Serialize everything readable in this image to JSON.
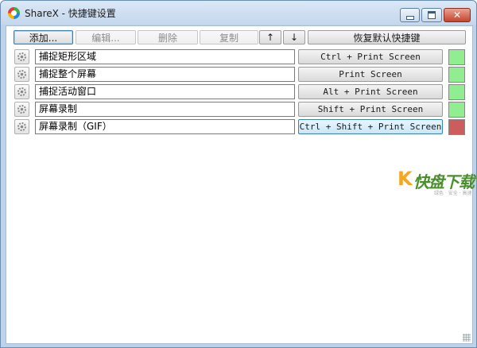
{
  "window": {
    "title": "ShareX - 快捷键设置",
    "close_glyph": "✕"
  },
  "toolbar": {
    "add_label": "添加...",
    "edit_label": "编辑...",
    "delete_label": "删除",
    "copy_label": "复制",
    "move_up_label": "↑",
    "move_down_label": "↓",
    "reset_label": "恢复默认快捷键"
  },
  "hotkeys": [
    {
      "name": "捕捉矩形区域",
      "hotkey": "Ctrl + Print Screen",
      "status_color": "#90ee90",
      "status": "ok"
    },
    {
      "name": "捕捉整个屏幕",
      "hotkey": "Print Screen",
      "status_color": "#90ee90",
      "status": "ok"
    },
    {
      "name": "捕捉活动窗口",
      "hotkey": "Alt + Print Screen",
      "status_color": "#90ee90",
      "status": "ok"
    },
    {
      "name": "屏幕录制",
      "hotkey": "Shift + Print Screen",
      "status_color": "#90ee90",
      "status": "ok"
    },
    {
      "name": "屏幕录制（GIF）",
      "hotkey": "Ctrl + Shift + Print Screen",
      "status_color": "#cd5c5c",
      "status": "failed"
    }
  ],
  "watermark": {
    "logo_glyph": "K",
    "text": "快盘下载",
    "subtext": "绿色 · 安全 · 高速"
  },
  "colors": {
    "status_ok": "#90ee90",
    "status_failed": "#cd5c5c",
    "accent": "#3c7fb1"
  }
}
